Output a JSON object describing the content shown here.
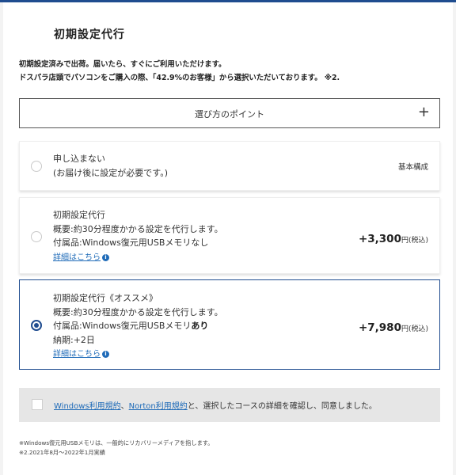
{
  "header": {
    "title": "初期設定代行"
  },
  "description": {
    "line1": "初期設定済みで出荷。届いたら、すぐにご利用いただけます。",
    "line2": "ドスパラ店頭でパソコンをご購入の際、「42.9%のお客様」から選択いただいております。 ※2."
  },
  "points": {
    "label": "選び方のポイント",
    "plus": "+"
  },
  "options": [
    {
      "selected": false,
      "line1": "申し込まない",
      "line2": "(お届け後に設定が必要です。)",
      "right_label": "基本構成"
    },
    {
      "selected": false,
      "line1": "初期設定代行",
      "line2": "概要:約30分程度かかる設定を代行します。",
      "line3": "付属品:Windows復元用USBメモリなし",
      "link": "詳細はこちら",
      "price": "+3,300",
      "tax": "円(税込)"
    },
    {
      "selected": true,
      "line1": "初期設定代行《オススメ》",
      "line2": "概要:約30分程度かかる設定を代行します。",
      "line3_prefix": "付属品:Windows復元用USBメモリ",
      "line3_bold": "あり",
      "line4": "納期:+2日",
      "link": "詳細はこちら",
      "price": "+7,980",
      "tax": "円(税込)"
    }
  ],
  "agreement": {
    "link1": "Windows利用規約",
    "sep": "、",
    "link2": "Norton利用規約",
    "rest": "と、選択したコースの詳細を確認し、同意しました。"
  },
  "notes": {
    "line1": "※Windows復元用USBメモリは、一般的にリカバリーメディアを指します。",
    "line2": "※2.2021年8月〜2022年1月実績"
  },
  "colors": {
    "accent": "#1f4c8f",
    "link": "#1f6bb8",
    "agree_bg": "#e6e6e6"
  },
  "icons": {
    "info": "info-icon",
    "radio": "radio-button",
    "checkbox": "checkbox",
    "expand": "plus-icon"
  }
}
